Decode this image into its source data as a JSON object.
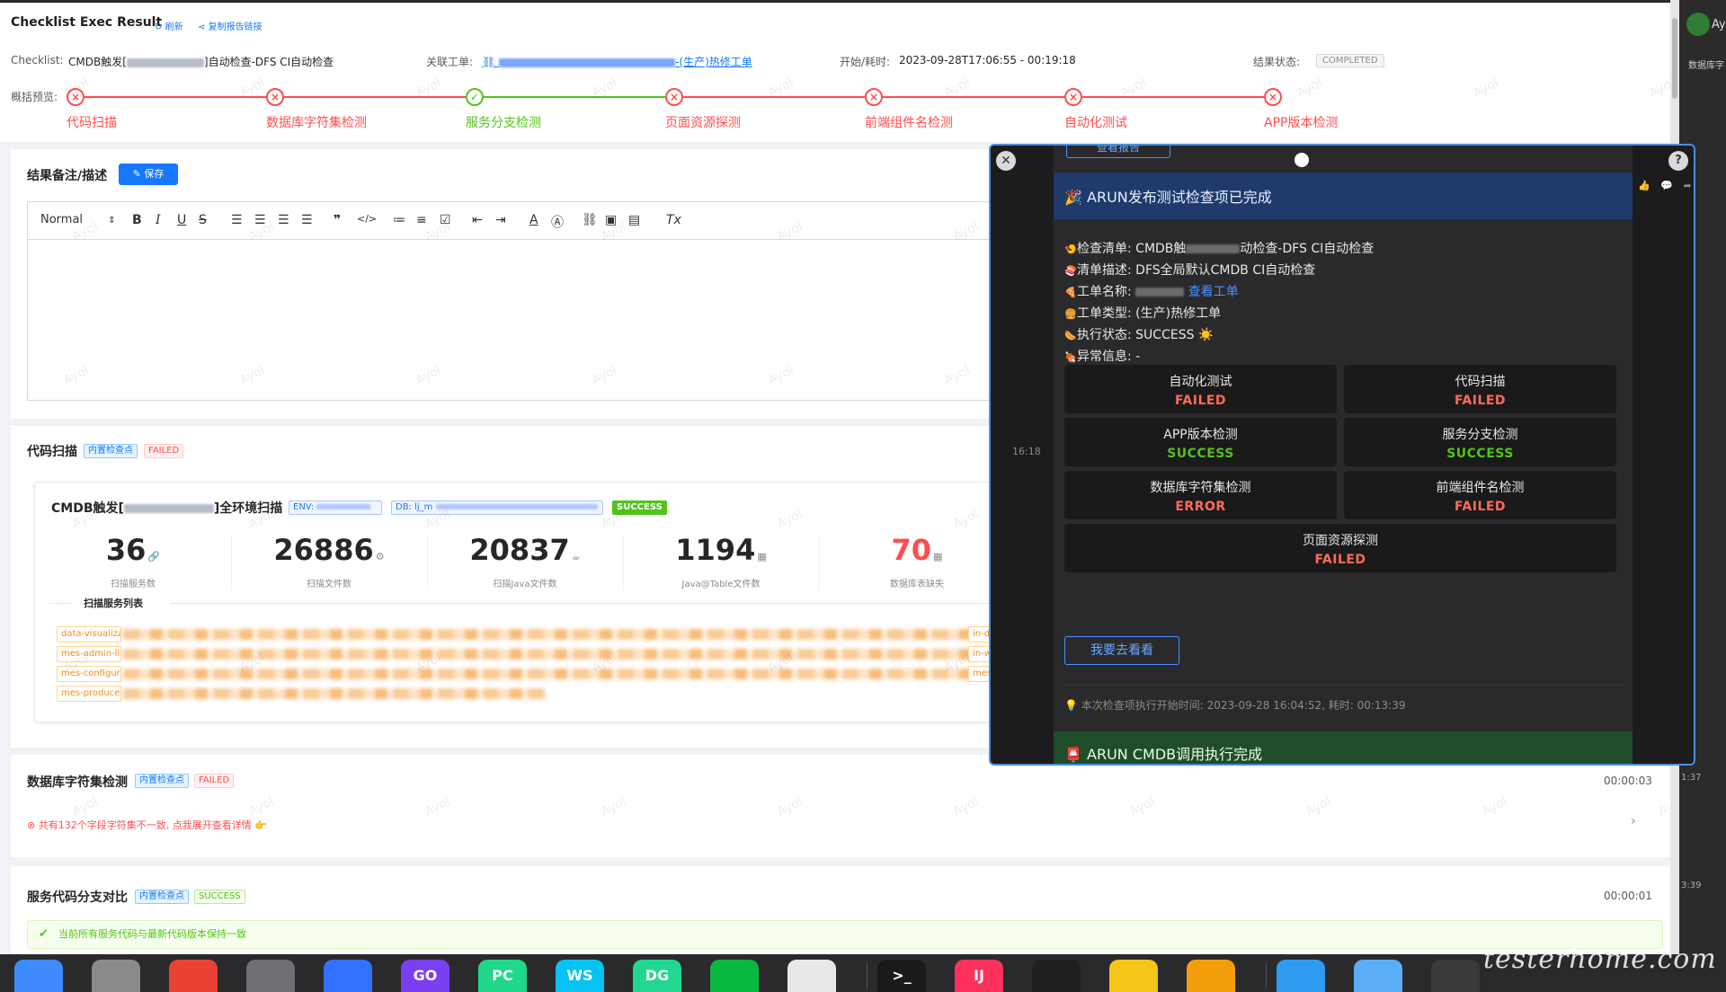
{
  "header": {
    "title": "Checklist Exec Result",
    "refresh_label": "刷新",
    "copy_link_label": "复制报告链接",
    "checklist_label": "Checklist:",
    "checklist_value_prefix": "CMDB触发[",
    "checklist_value_suffix": "]自动检查-DFS CI自动检查",
    "ticket_label": "关联工单:",
    "ticket_value_suffix": "-(生产)热修工单",
    "time_label": "开始/耗时:",
    "time_value": "2023-09-28T17:06:55 - 00:19:18",
    "status_label": "结果状态:",
    "status_value": "COMPLETED",
    "overview_label": "概括预览:"
  },
  "steps": [
    {
      "label": "代码扫描",
      "status": "failed"
    },
    {
      "label": "数据库字符集检测",
      "status": "failed"
    },
    {
      "label": "服务分支检测",
      "status": "success"
    },
    {
      "label": "页面资源探测",
      "status": "failed"
    },
    {
      "label": "前端组件名检测",
      "status": "failed"
    },
    {
      "label": "自动化测试",
      "status": "failed"
    },
    {
      "label": "APP版本检测",
      "status": "failed"
    }
  ],
  "remark": {
    "title": "结果备注/描述",
    "save_label": "保存",
    "toolbar_normal": "Normal"
  },
  "code_scan": {
    "title": "代码扫描",
    "tag_builtin": "内置检查点",
    "tag_status": "FAILED",
    "card_title_prefix": "CMDB触发[",
    "card_title_suffix": "]全环境扫描",
    "env_label": "ENV: ",
    "db_label": "DB: lj_m",
    "card_status": "SUCCESS",
    "stats": [
      {
        "value": "36",
        "label": "扫描服务数"
      },
      {
        "value": "26886",
        "label": "扫描文件数"
      },
      {
        "value": "20837",
        "label": "扫描Java文件数"
      },
      {
        "value": "1194",
        "label": "Java@Table文件数"
      },
      {
        "value": "70",
        "label": "数据库表缺失"
      }
    ],
    "service_list_title": "扫描服务列表",
    "services": [
      "data-visualizat",
      "mes-admin-lite",
      "mes-configura",
      "mes-produce-p"
    ],
    "right_chips": [
      "in-de",
      "in-w",
      "mes-"
    ]
  },
  "db_charset": {
    "title": "数据库字符集检测",
    "tag_builtin": "内置检查点",
    "tag_status": "FAILED",
    "duration": "00:00:03",
    "message": "共有132个字段字符集不一致, 点我展开查看详情 👉"
  },
  "branch_compare": {
    "title": "服务代码分支对比",
    "tag_builtin": "内置检查点",
    "tag_status": "SUCCESS",
    "duration": "00:00:01",
    "message": "当前所有服务代码与最新代码版本保持一致"
  },
  "watermark_text": "Ayol",
  "right_strip": {
    "avatar_text": "Ay",
    "label": "数据库字",
    "t1": "1:37",
    "t2": "3:39"
  },
  "popup": {
    "timestamp": "16:18",
    "top_button": "查看报告",
    "title": "ARUN发布测试检查项已完成",
    "lines": [
      {
        "icon": "🍤",
        "label": "检查清单: ",
        "value": "CMDB触",
        "value2": "动检查-DFS CI自动检查"
      },
      {
        "icon": "🍣",
        "label": "清单描述: ",
        "value": "DFS全局默认CMDB CI自动检查",
        "value2": ""
      },
      {
        "icon": "🍕",
        "label": "工单名称: ",
        "value": "",
        "value2": ""
      },
      {
        "icon": "🍔",
        "label": "工单类型: ",
        "value": "(生产)热修工单",
        "value2": ""
      },
      {
        "icon": "🌭",
        "label": "执行状态: ",
        "value": "SUCCESS ☀️",
        "value2": ""
      },
      {
        "icon": "🍖",
        "label": "异常信息: ",
        "value": "-",
        "value2": ""
      }
    ],
    "ticket_link": "查看工单",
    "results": [
      {
        "name": "自动化测试",
        "status": "FAILED",
        "kind": "failed"
      },
      {
        "name": "代码扫描",
        "status": "FAILED",
        "kind": "failed"
      },
      {
        "name": "APP版本检测",
        "status": "SUCCESS",
        "kind": "success"
      },
      {
        "name": "服务分支检测",
        "status": "SUCCESS",
        "kind": "success"
      },
      {
        "name": "数据库字符集检测",
        "status": "ERROR",
        "kind": "error"
      },
      {
        "name": "前端组件名检测",
        "status": "FAILED",
        "kind": "failed"
      },
      {
        "name": "页面资源探测",
        "status": "FAILED",
        "kind": "failed"
      }
    ],
    "action_button": "我要去看看",
    "note": "本次检查项执行开始时间: 2023-09-28 16:04:52, 耗时: 00:13:39",
    "second_title": "ARUN CMDB调用执行完成"
  },
  "dock": {
    "apps": [
      {
        "name": "finder-icon",
        "text": "",
        "color": "#3d8bfd"
      },
      {
        "name": "launchpad-icon",
        "text": "",
        "color": "#8a8a8a"
      },
      {
        "name": "chrome-icon",
        "text": "",
        "color": "#e94235"
      },
      {
        "name": "settings-icon",
        "text": "",
        "color": "#6e6e73"
      },
      {
        "name": "feishu-icon",
        "text": "",
        "color": "#3370ff"
      },
      {
        "name": "goland-icon",
        "text": "GO",
        "color": "#7b3ff2"
      },
      {
        "name": "pycharm-icon",
        "text": "PC",
        "color": "#21d789"
      },
      {
        "name": "webstorm-icon",
        "text": "WS",
        "color": "#07c3f2"
      },
      {
        "name": "datagrip-icon",
        "text": "DG",
        "color": "#22d88f"
      },
      {
        "name": "wechat-icon",
        "text": "",
        "color": "#09b83e"
      },
      {
        "name": "app-icon",
        "text": "",
        "color": "#e8e8e8"
      },
      {
        "name": "terminal-icon",
        "text": ">_",
        "color": "#1a1a1a"
      },
      {
        "name": "intellij-icon",
        "text": "IJ",
        "color": "#fe315d"
      },
      {
        "name": "vscode-icon",
        "text": "",
        "color": "#1f1f1f"
      },
      {
        "name": "chrome-canary-icon",
        "text": "",
        "color": "#f5c518"
      },
      {
        "name": "instruments-icon",
        "text": "",
        "color": "#f59e0b"
      },
      {
        "name": "folder-icon",
        "text": "",
        "color": "#2f9bf0"
      },
      {
        "name": "folder-icon-2",
        "text": "",
        "color": "#5aaef5"
      },
      {
        "name": "window-preview-icon",
        "text": "",
        "color": "#3a3a3c"
      }
    ],
    "brand": "testerhome.com"
  }
}
